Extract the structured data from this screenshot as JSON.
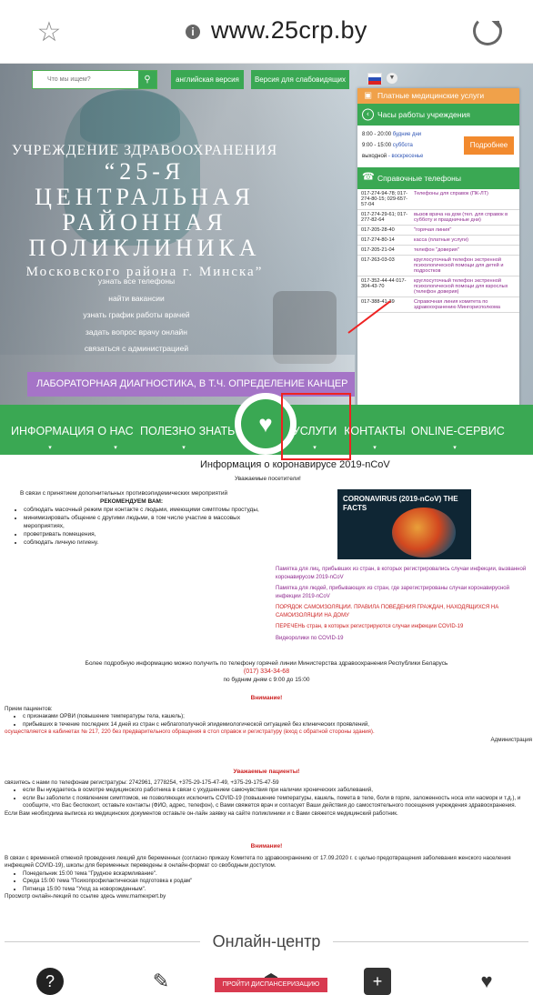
{
  "browser": {
    "url": "www.25crp.by"
  },
  "header": {
    "search_placeholder": "Что мы ищем?",
    "english_btn": "английская версия",
    "low_vision_btn": "Версия для слабовидящих"
  },
  "hero": {
    "line1": "УЧРЕЖДЕНИЕ ЗДРАВООХРАНЕНИЯ",
    "line2": "“25-Я ЦЕНТРАЛЬНАЯ",
    "line3": "РАЙОННАЯ",
    "line4": "ПОЛИКЛИНИКА",
    "line5": "Московского района г. Минска”",
    "quick_links": [
      "узнать все телефоны",
      "найти вакансии",
      "узнать график работы врачей",
      "задать вопрос врачу онлайн",
      "связаться с администрацией"
    ],
    "banner": "ЛАБОРАТОРНАЯ ДИАГНОСТИКА, В Т.Ч. ОПРЕДЕЛЕНИЕ КАНЦЕР"
  },
  "panel": {
    "paid": "Платные медицинские услуги",
    "hours_title": "Часы работы учреждения",
    "hours": [
      {
        "time": "8:00 - 20:00",
        "days": "будние дни"
      },
      {
        "time": "9:00 - 15:00",
        "days": "суббота"
      },
      {
        "time": "выходной",
        "days": "- воскресенье"
      }
    ],
    "more": "Подробнее",
    "phones_title": "Справочные телефоны",
    "phones": [
      {
        "n": "017-274-94-78; 017-274-80-15; 029-657-57-04",
        "d": "Телефоны для справок (ПК-ЛТ)"
      },
      {
        "n": "017-274-29-61; 017-277-82-64",
        "d": "вызов врача на дом (тел. для справок в субботу и праздничные дни)"
      },
      {
        "n": "017-205-28-40",
        "d": "\"горячая линия\""
      },
      {
        "n": "017-274-80-14",
        "d": "касса (платные услуги)"
      },
      {
        "n": "017-205-21-04",
        "d": "телефон \"доверия\""
      },
      {
        "n": "017-263-03-03",
        "d": "круглосуточный телефон экстренной психологической помощи для детей и подростков"
      },
      {
        "n": "017-352-44-44 017-304-43-70",
        "d": "круглосуточный телефон экстренной психологической помощи для взрослых (телефон доверия)"
      },
      {
        "n": "017-388-41-39",
        "d": "Справочная линия комитета по здравоохранению Мингорисполкома"
      }
    ]
  },
  "menu": {
    "info": "ИНФОРМАЦИЯ",
    "about": "О НАС",
    "useful": "ПОЛЕЗНО ЗНАТЬ",
    "services": "УСЛУГИ",
    "contacts": "КОНТАКТЫ",
    "online": "ONLINE-СЕРВИС"
  },
  "content": {
    "title": "Информация о коронавирусе 2019-nCoV",
    "greeting": "Уважаемые посетители!",
    "intro": "В связи с принятием дополнительных противоэпидемических мероприятий",
    "recommend": "РЕКОМЕНДУЕМ ВАМ:",
    "recs": [
      "соблюдать масочный режим при контакте с людьми, имеющими симптомы простуды,",
      "минимизировать общение с другими людьми, в том числе участие в массовых мероприятиях,",
      "проветривать помещения,",
      "соблюдать личную гигиену."
    ],
    "cv_title": "CORONAVIRUS (2019-nCoV) THE FACTS",
    "links": [
      "Памятка для лиц, прибывших из стран, в которых регистрировались случаи инфекции, вызванной коронавирусом 2019-nCoV",
      "Памятка для людей, прибывающих из стран, где зарегистрированы случаи коронавирусной инфекции 2019-nCoV",
      "ПОРЯДОК САМОИЗОЛЯЦИИ. ПРАВИЛА ПОВЕДЕНИЯ ГРАЖДАН, НАХОДЯЩИХСЯ НА САМОИЗОЛЯЦИИ НА ДОМУ",
      "ПЕРЕЧЕНЬ стран, в которых регистрируются случаи инфекции COVID-19",
      "Видеоролики по COVID-19"
    ],
    "hotline1": "Более подробную информацию можно получить по телефону горячей линии Министерства здравоохранения Республики Беларусь",
    "hotline_num": "(017) 334-34-68",
    "hotline2": "по будним дням с 9:00 до 15:00",
    "attention": "Внимание!",
    "reception": "Прием пациентов:",
    "reception_items": [
      "с признаками ОРВИ (повышение температуры тела, кашель);",
      "прибывших в течение последних 14 дней из стран с неблагополучной эпидемиологической ситуацией без клинических проявлений,"
    ],
    "cabinets": "осуществляется в кабинетах № 217, 220 без предварительного обращения в стол справок и регистратуру (вход с обратной стороны здания).",
    "admin": "Администрация",
    "dear_patients": "Уважаемые пациенты!",
    "contact_line": "связитесь с нами по телефонам регистратуры: 2742961, 2778254, +375-29-175-47-49, +375-29-175-47-59",
    "bullets2": [
      "если Вы нуждаетесь в осмотре медицинского работника в связи с ухудшением самочувствия при наличии хронических заболеваний,",
      "если Вы заболели с появлением симптомов, не позволяющих исключить COVID-19 (повышение температуры, кашель, помета в теле, боли в горле, заложенность носа или насморк и т.д.), и сообщите, что Вас беспокоит, оставьте контакты (ФИО, адрес, телефон), с Вами свяжется врач и согласует Ваши действия до самостоятельного посещения учреждения здравоохранения."
    ],
    "extract_line": "Если Вам необходима выписка из медицинских документов оставьте он-лайн заявку на сайте поликлиники и с Вами свяжется медицинский работник.",
    "attention2": "Внимание!",
    "lectures": "В связи с временной отменой проведения лекций для беременных (согласно приказу Комитета по здравоохранению от 17.09.2020 г. с целью предотвращения заболевания женского населения инфекцией COVID-19), школы для беременных переведены в онлайн-формат со свободным доступом.",
    "schedule": [
      "Понедельник 15:00 тема \"Грудное вскармливание\".",
      "Среда 15:00 тема \"Психопрофилактическая подготовка к родам\"",
      "Пятница 15:00 тема \"Уход за новорожденным\"."
    ],
    "view": "Просмотр онлайн-лекций по ссылке здесь www.mamexpert.by"
  },
  "online_center": "Онлайн-центр",
  "dispensary_btn": "ПРОЙТИ ДИСПАНСЕРИЗАЦИЮ"
}
